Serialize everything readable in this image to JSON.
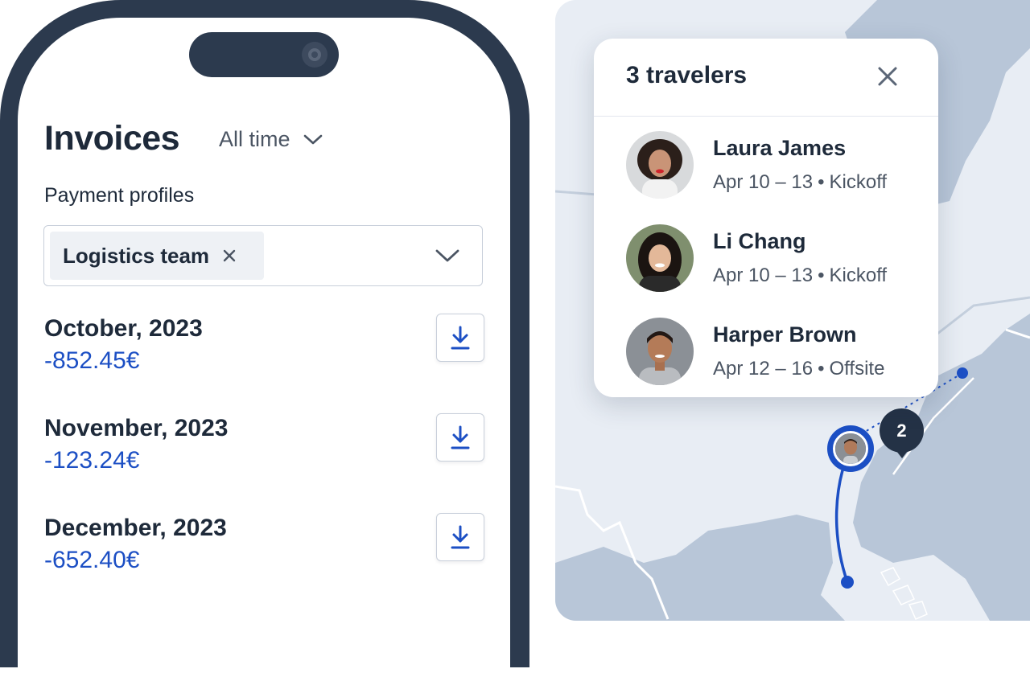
{
  "invoices": {
    "title": "Invoices",
    "filter_label": "All time",
    "payment_profiles_label": "Payment profiles",
    "selected_profile": "Logistics team",
    "items": [
      {
        "month": "October, 2023",
        "amount": "-852.45€"
      },
      {
        "month": "November, 2023",
        "amount": "-123.24€"
      },
      {
        "month": "December, 2023",
        "amount": "-652.40€"
      }
    ]
  },
  "travelers_card": {
    "title": "3 travelers",
    "travelers": [
      {
        "name": "Laura James",
        "dates": "Apr 10 – 13",
        "event": "Kickoff"
      },
      {
        "name": "Li Chang",
        "dates": "Apr 10 – 13",
        "event": "Kickoff"
      },
      {
        "name": "Harper Brown",
        "dates": "Apr 12 – 16",
        "event": "Offsite"
      }
    ]
  },
  "map": {
    "cluster_count": "2"
  },
  "colors": {
    "accent_blue": "#1c4fc4",
    "dark_navy": "#2c3a4e",
    "land": "#b8c6d8",
    "water": "#e8edf4"
  }
}
